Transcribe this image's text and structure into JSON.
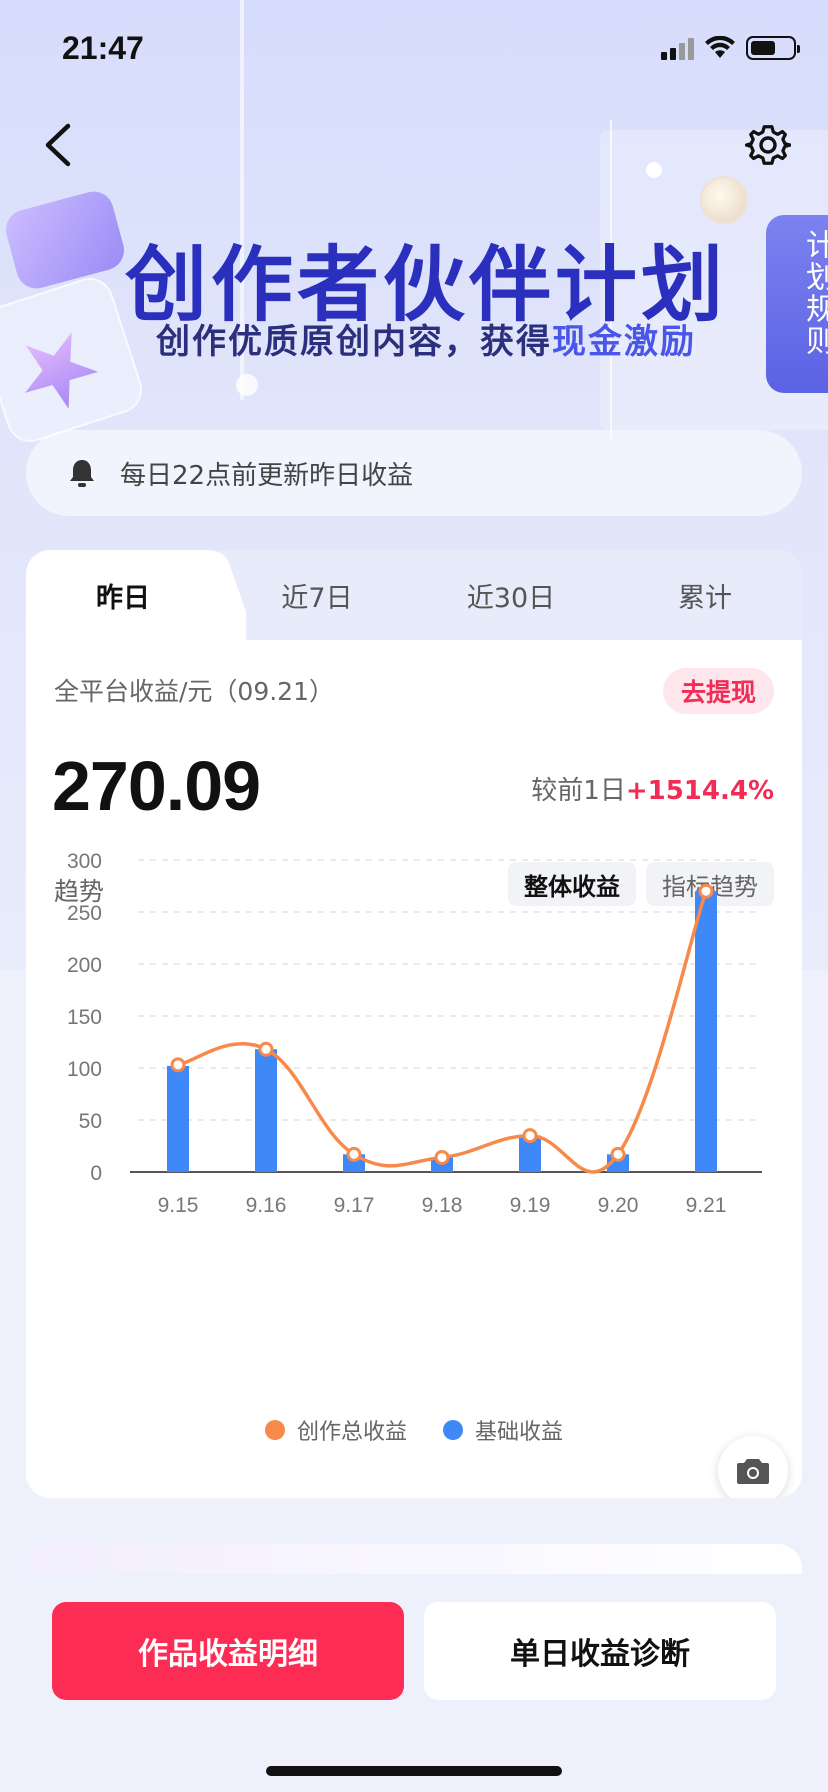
{
  "status_bar": {
    "time": "21:47"
  },
  "hero": {
    "title": "创作者伙伴计划",
    "subtitle_prefix": "创作优质原创内容，获得",
    "subtitle_highlight": "现金激励",
    "plan_rules": "计划规则"
  },
  "notice": {
    "text": "每日22点前更新昨日收益",
    "icon": "bell-icon"
  },
  "tabs": [
    {
      "label": "昨日",
      "active": true
    },
    {
      "label": "近7日",
      "active": false
    },
    {
      "label": "近30日",
      "active": false
    },
    {
      "label": "累计",
      "active": false
    }
  ],
  "earnings": {
    "label": "全平台收益/元（09.21）",
    "withdraw_label": "去提现",
    "amount": "270.09",
    "compare_prefix": "较前1日",
    "compare_pct": "+1514.4%"
  },
  "trend": {
    "label": "趋势",
    "buttons": [
      {
        "label": "整体收益",
        "active": true
      },
      {
        "label": "指标趋势",
        "active": false
      }
    ]
  },
  "chart_data": {
    "type": "bar",
    "categories": [
      "9.15",
      "9.16",
      "9.17",
      "9.18",
      "9.19",
      "9.20",
      "9.21"
    ],
    "ylim": [
      0,
      300
    ],
    "yticks": [
      0,
      50,
      100,
      150,
      200,
      250,
      300
    ],
    "series": [
      {
        "name": "创作总收益",
        "type": "line",
        "color": "#f7894a",
        "values": [
          103,
          118,
          17,
          14,
          35,
          17,
          270
        ]
      },
      {
        "name": "基础收益",
        "type": "bar",
        "color": "#3e88f7",
        "values": [
          102,
          118,
          17,
          14,
          35,
          17,
          270
        ]
      }
    ],
    "grid": true,
    "legend_position": "bottom"
  },
  "actions": {
    "primary": "作品收益明细",
    "secondary": "单日收益诊断"
  },
  "colors": {
    "accent_red": "#fc2c55",
    "title_blue": "#2a2fbd",
    "bar_blue": "#3e88f7",
    "line_orange": "#f7894a"
  }
}
